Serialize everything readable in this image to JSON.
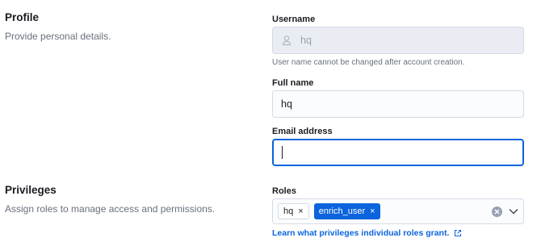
{
  "profile": {
    "title": "Profile",
    "description": "Provide personal details."
  },
  "privileges": {
    "title": "Privileges",
    "description": "Assign roles to manage access and permissions."
  },
  "fields": {
    "username": {
      "label": "Username",
      "value": "hq",
      "help": "User name cannot be changed after account creation."
    },
    "full_name": {
      "label": "Full name",
      "value": "hq"
    },
    "email": {
      "label": "Email address",
      "value": ""
    },
    "roles": {
      "label": "Roles",
      "selected": [
        "hq",
        "enrich_user"
      ],
      "remove_glyph": "×",
      "link_text": "Learn what privileges individual roles grant."
    }
  },
  "colors": {
    "accent": "#0b64dd",
    "muted_text": "#69707d",
    "border": "#d3dae6"
  }
}
